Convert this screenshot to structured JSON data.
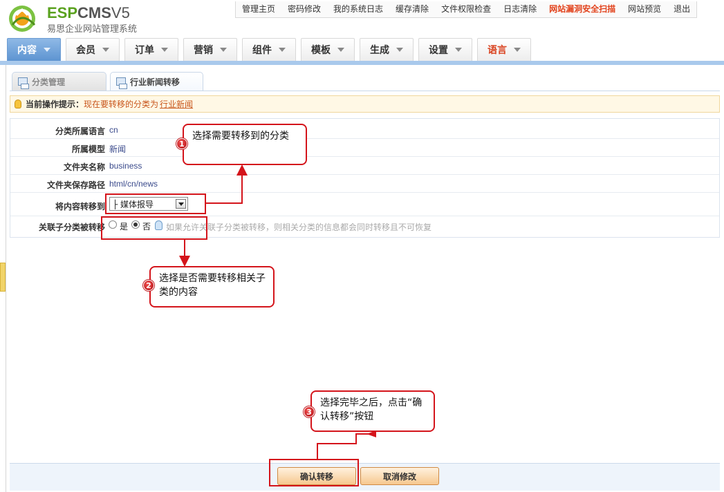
{
  "logo": {
    "brand_a": "ESP",
    "brand_b": "CMS",
    "brand_c": "V5",
    "subtitle": "易思企业网站管理系统"
  },
  "topnav": [
    {
      "label": "管理主页"
    },
    {
      "label": "密码修改"
    },
    {
      "label": "我的系统日志"
    },
    {
      "label": "缓存清除"
    },
    {
      "label": "文件权限检查"
    },
    {
      "label": "日志清除"
    },
    {
      "label": "网站漏洞安全扫描",
      "warn": true
    },
    {
      "label": "网站预览"
    },
    {
      "label": "退出"
    }
  ],
  "mainnav": [
    "内容",
    "会员",
    "订单",
    "营销",
    "组件",
    "模板",
    "生成",
    "设置",
    "语言"
  ],
  "tabs": {
    "tab1": "分类管理",
    "tab2": "行业新闻转移"
  },
  "tip": {
    "label": "当前操作提示：",
    "message": "现在要转移的分类为",
    "link": "行业新闻"
  },
  "form": {
    "lang_label": "分类所属语言",
    "lang_value": "cn",
    "model_label": "所属模型",
    "model_value": "新闻",
    "folder_label": "文件夹名称",
    "folder_value": "business",
    "path_label": "文件夹保存路径",
    "path_value": "html/cn/news",
    "move_label": "将内容转移到",
    "move_selected": "├ 媒体报导",
    "sub_label": "关联子分类被转移",
    "sub_yes": "是",
    "sub_no": "否",
    "sub_selected": "否",
    "sub_hint": "如果允许关联子分类被转移，则相关分类的信息都会同时转移且不可恢复"
  },
  "buttons": {
    "confirm": "确认转移",
    "cancel": "取消修改"
  },
  "callouts": {
    "c1_num": "1",
    "c1_text": "选择需要转移到的分类",
    "c2_num": "2",
    "c2_text": "选择是否需要转移相关子类的内容",
    "c3_num": "3",
    "c3_text": "选择完毕之后，点击“确认转移”按钮"
  },
  "colors": {
    "accent_red": "#d4141b",
    "nav_active": "#5d94d1",
    "tip_text": "#c8551b"
  }
}
